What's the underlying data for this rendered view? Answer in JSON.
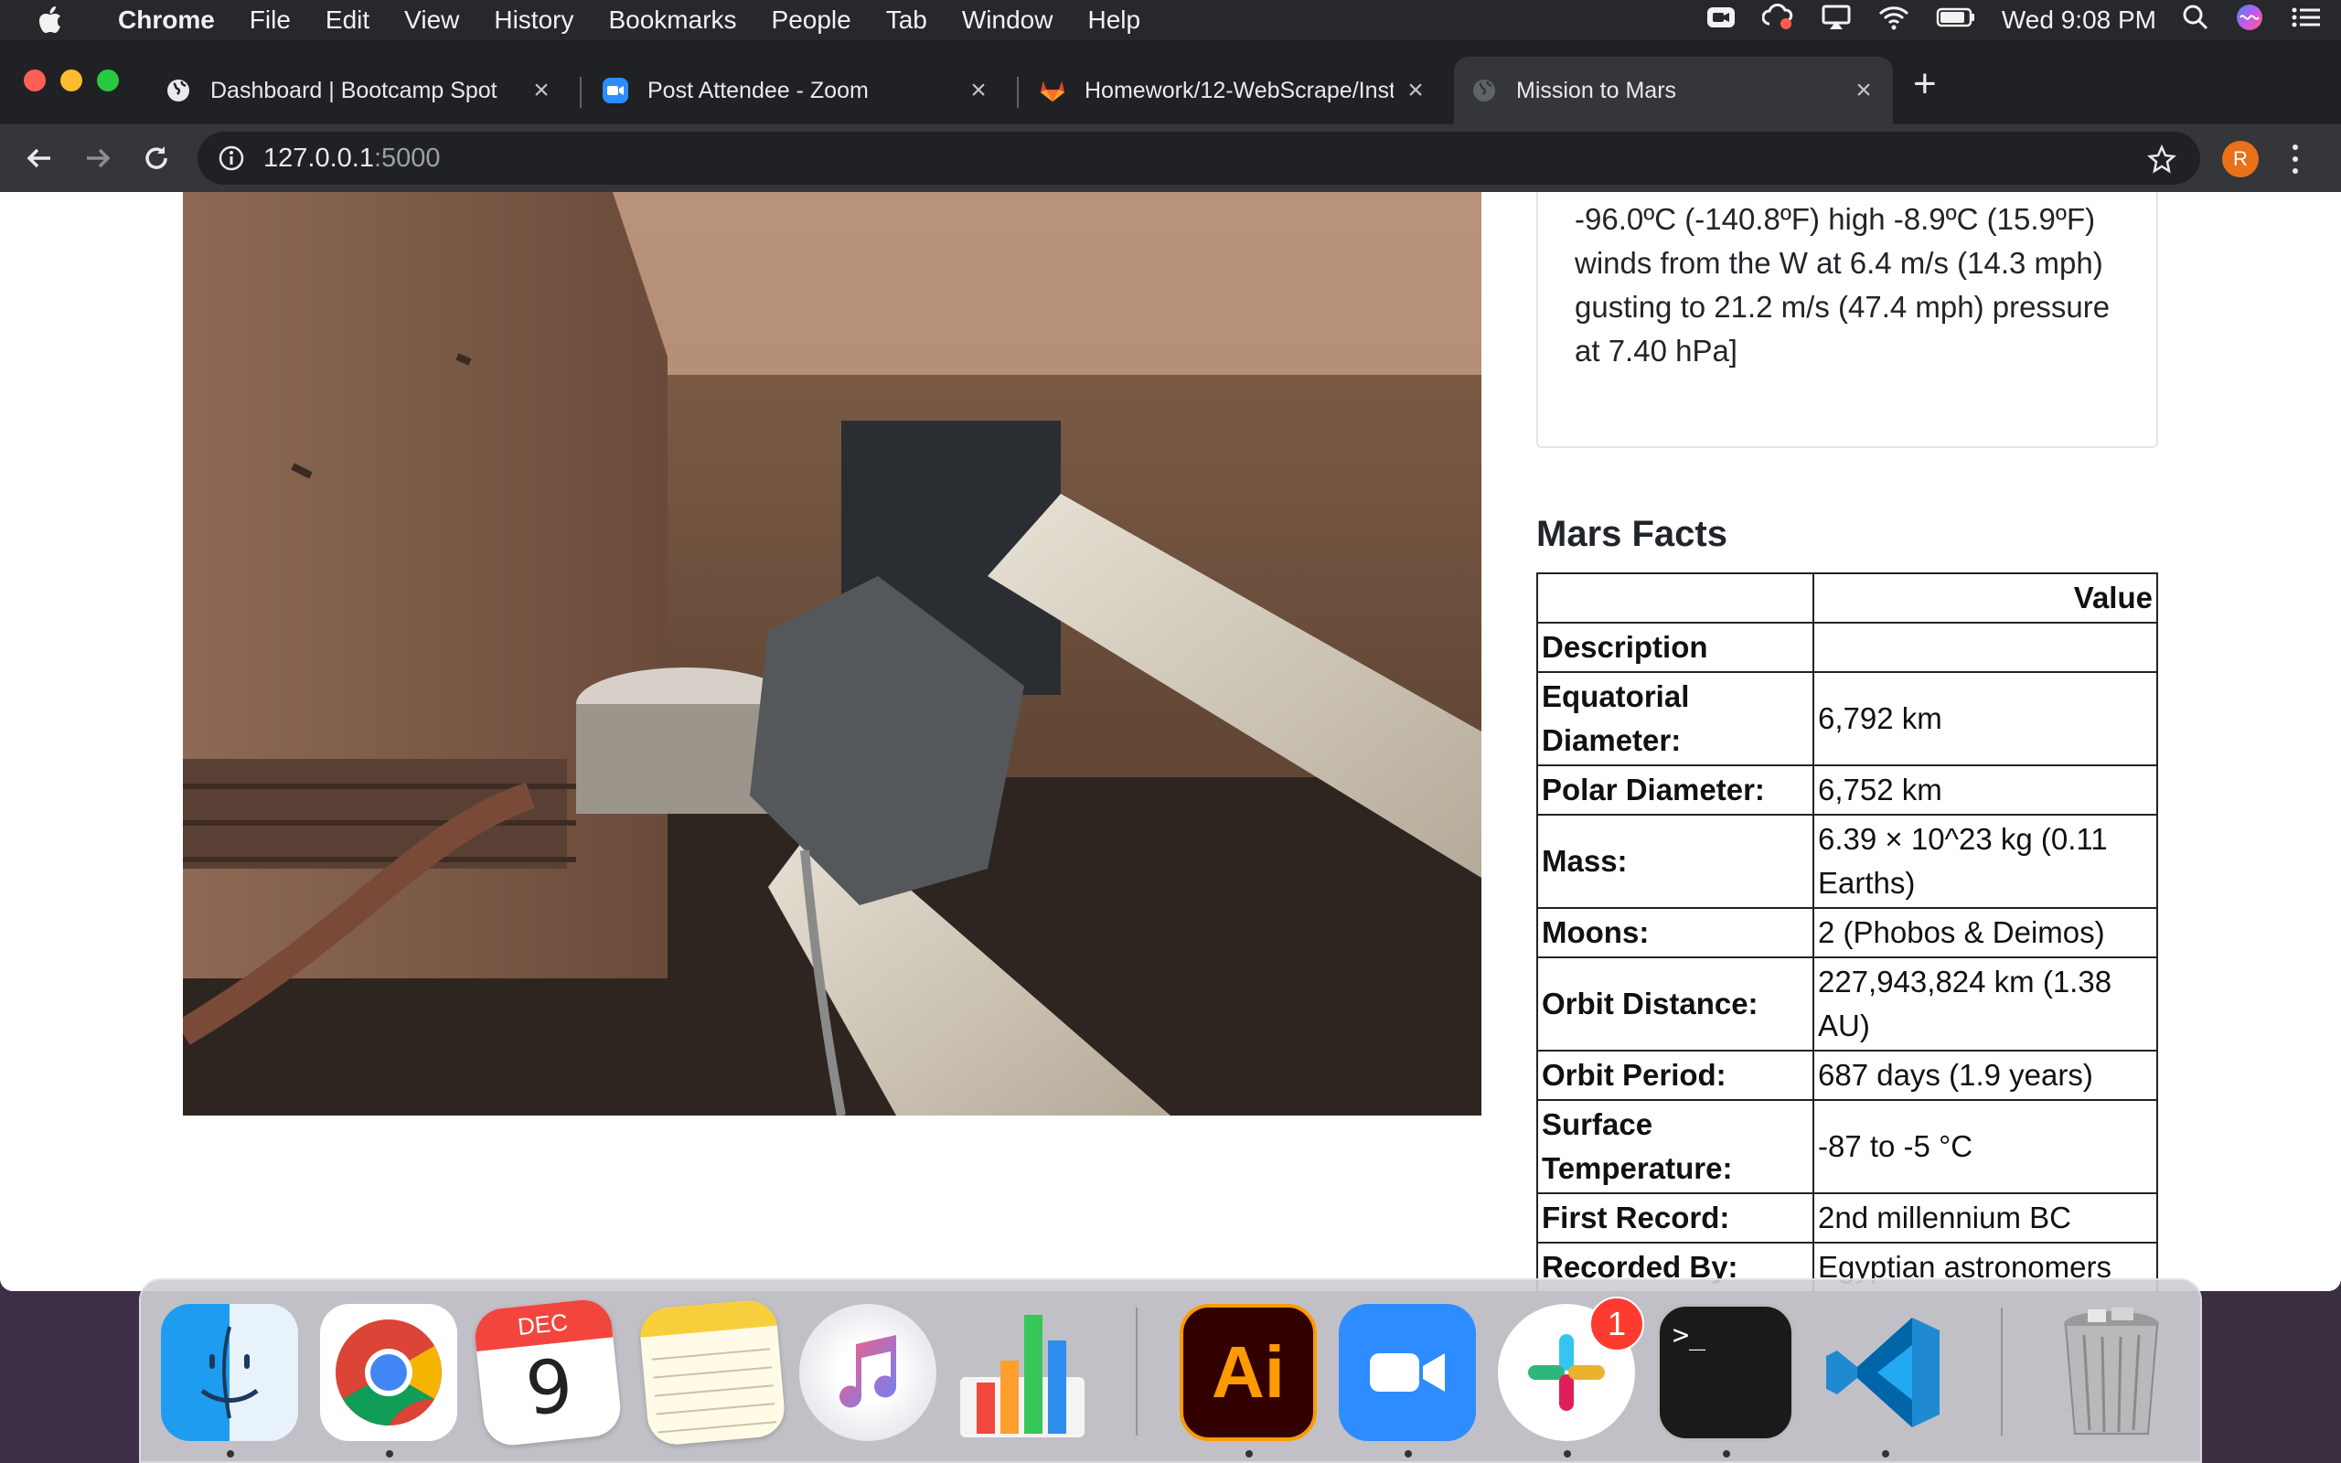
{
  "menubar": {
    "app_name": "Chrome",
    "menus": [
      "File",
      "Edit",
      "View",
      "History",
      "Bookmarks",
      "People",
      "Tab",
      "Window",
      "Help"
    ],
    "clock": "Wed 9:08 PM"
  },
  "tabs": [
    {
      "title": "Dashboard | Bootcamp Spot",
      "icon": "globe-icon",
      "active": false
    },
    {
      "title": "Post Attendee - Zoom",
      "icon": "zoom-icon",
      "active": false
    },
    {
      "title": "Homework/12-WebScrape/Instr",
      "icon": "gitlab-icon",
      "active": false
    },
    {
      "title": "Mission to Mars",
      "icon": "globe-icon",
      "active": true
    }
  ],
  "omnibox": {
    "host": "127.0.0.1",
    "port": ":5000"
  },
  "profile_initial": "R",
  "weather": {
    "text": "-96.0ºC (-140.8ºF) high -8.9ºC (15.9ºF) winds from the W at 6.4 m/s (14.3 mph) gusting to 21.2 m/s (47.4 mph) pressure at 7.40 hPa]"
  },
  "facts": {
    "title": "Mars Facts",
    "value_header": "Value",
    "rows": [
      {
        "key": "Description",
        "value": ""
      },
      {
        "key": "Equatorial Diameter:",
        "value": "6,792 km"
      },
      {
        "key": "Polar Diameter:",
        "value": "6,752 km"
      },
      {
        "key": "Mass:",
        "value": "6.39 × 10^23 kg (0.11 Earths)"
      },
      {
        "key": "Moons:",
        "value": "2 (Phobos & Deimos)"
      },
      {
        "key": "Orbit Distance:",
        "value": "227,943,824 km (1.38 AU)"
      },
      {
        "key": "Orbit Period:",
        "value": "687 days (1.9 years)"
      },
      {
        "key": "Surface Temperature:",
        "value": "-87 to -5 °C"
      },
      {
        "key": "First Record:",
        "value": "2nd millennium BC"
      },
      {
        "key": "Recorded By:",
        "value": "Egyptian astronomers"
      }
    ]
  },
  "dock": {
    "calendar_month": "DEC",
    "calendar_day": "9",
    "illustrator_label": "Ai",
    "slack_badge": "1",
    "terminal_prompt": ">_"
  },
  "colors": {
    "menubar_bg": "#26282b",
    "tabstrip_bg": "#202124",
    "toolbar_bg": "#35363a",
    "mars_sky": "#a88565",
    "profile_orange": "#e8711a"
  }
}
